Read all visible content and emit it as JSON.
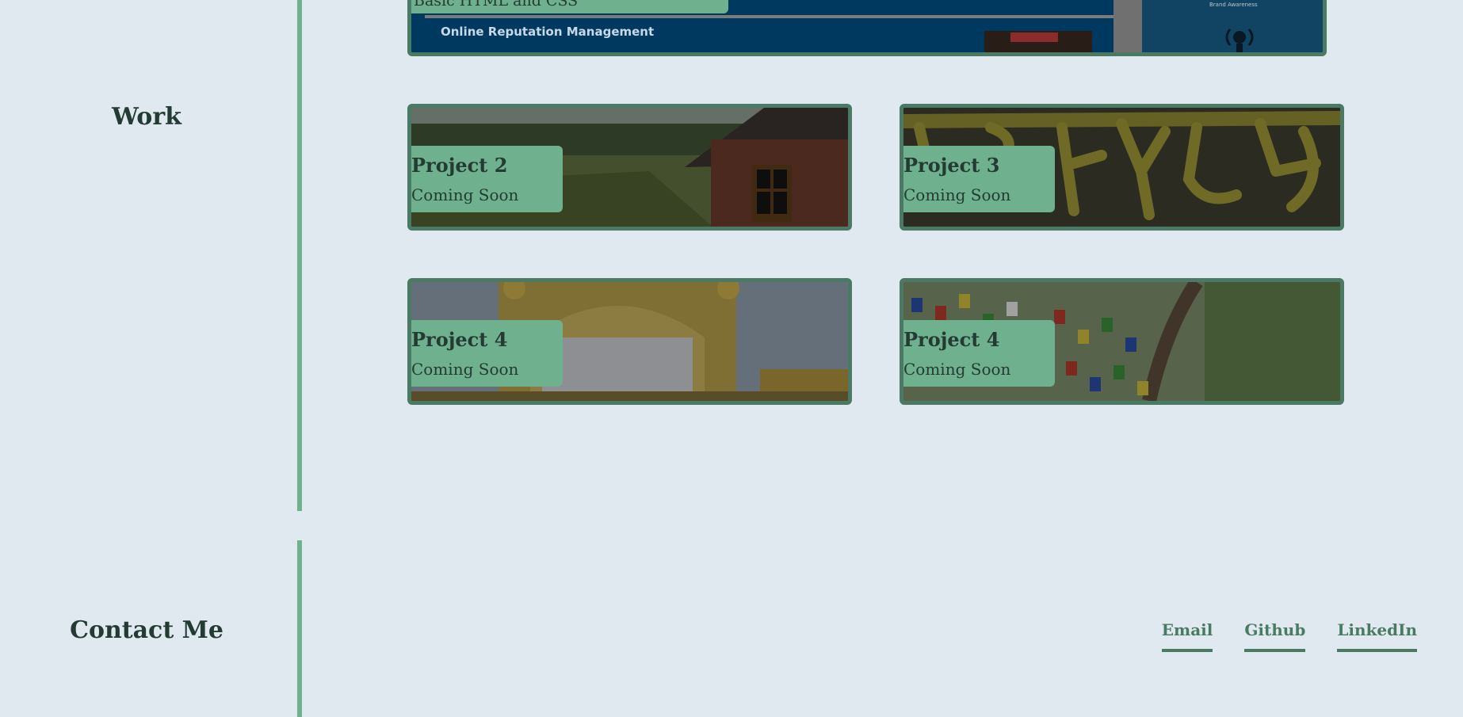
{
  "top_project": {
    "caption": "Basic HTML and CSS",
    "banner_text": "Online Reputation Management",
    "badge_text": "Brand Awareness"
  },
  "work": {
    "title": "Work",
    "projects": [
      {
        "name": "Project 2",
        "status": "Coming Soon",
        "image": "village-house-image"
      },
      {
        "name": "Project 3",
        "status": "Coming Soon",
        "image": "carved-script-image"
      },
      {
        "name": "Project 4",
        "status": "Coming Soon",
        "image": "golden-temple-image"
      },
      {
        "name": "Project 4",
        "status": "Coming Soon",
        "image": "prayer-flags-image"
      }
    ]
  },
  "contact": {
    "title": "Contact Me",
    "links": [
      "Email",
      "Github",
      "LinkedIn"
    ]
  },
  "colors": {
    "background": "#dfe9ef",
    "accent": "#6fb08e",
    "accent_dark": "#4a7a63",
    "text": "#243b33"
  }
}
